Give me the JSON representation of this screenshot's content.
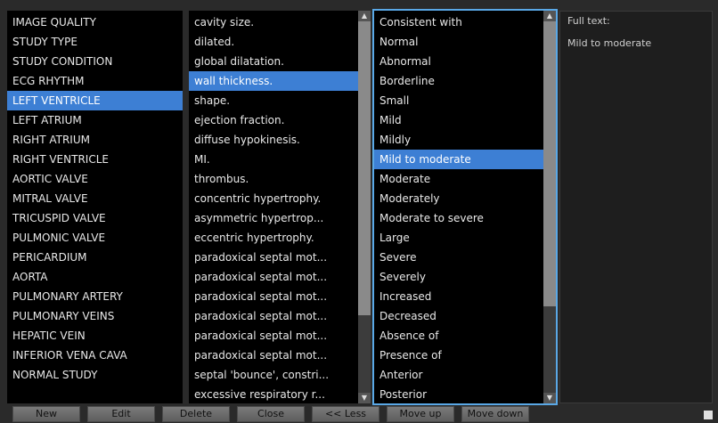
{
  "col1": {
    "items": [
      "IMAGE QUALITY",
      "STUDY TYPE",
      "STUDY CONDITION",
      "ECG RHYTHM",
      "LEFT VENTRICLE",
      "LEFT ATRIUM",
      "RIGHT ATRIUM",
      "RIGHT VENTRICLE",
      "AORTIC VALVE",
      "MITRAL VALVE",
      "TRICUSPID VALVE",
      "PULMONIC VALVE",
      "PERICARDIUM",
      "AORTA",
      "PULMONARY ARTERY",
      "PULMONARY VEINS",
      "HEPATIC VEIN",
      "INFERIOR VENA CAVA",
      "NORMAL STUDY"
    ],
    "selected_index": 4
  },
  "col2": {
    "items": [
      "cavity size.",
      "dilated.",
      "global dilatation.",
      "wall thickness.",
      "shape.",
      "ejection fraction.",
      "diffuse hypokinesis.",
      "MI.",
      "thrombus.",
      "concentric hypertrophy.",
      "asymmetric hypertrop...",
      "eccentric hypertrophy.",
      "paradoxical septal mot...",
      "paradoxical septal mot...",
      "paradoxical septal mot...",
      "paradoxical septal mot...",
      "paradoxical septal mot...",
      "paradoxical septal mot...",
      "septal 'bounce', constri...",
      "excessive respiratory r..."
    ],
    "selected_index": 3
  },
  "col3": {
    "items": [
      "Consistent with",
      "Normal",
      "Abnormal",
      "Borderline",
      "Small",
      "Mild",
      "Mildly",
      "Mild to moderate",
      "Moderate",
      "Moderately",
      "Moderate to severe",
      "Large",
      "Severe",
      "Severely",
      "Increased",
      "Decreased",
      "Absence of",
      "Presence of",
      "Anterior",
      "Posterior"
    ],
    "selected_index": 7
  },
  "fulltext": {
    "label": "Full text:",
    "value": "Mild to moderate"
  },
  "buttons": [
    "New",
    "Edit",
    "Delete",
    "Close",
    "<< Less",
    "Move up",
    "Move down"
  ],
  "colors": {
    "selection": "#3d7fd4",
    "focus_border": "#5aa8e6",
    "list_bg": "#000000"
  },
  "icons": {
    "scroll_up": "up-arrow-icon",
    "scroll_down": "down-arrow-icon"
  }
}
